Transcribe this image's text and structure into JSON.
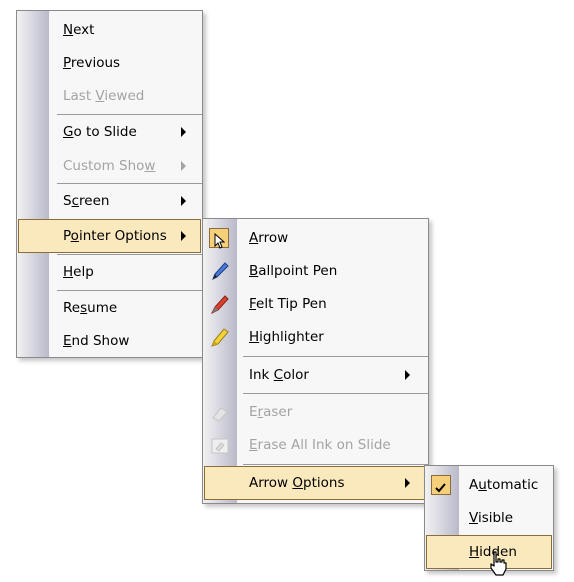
{
  "menu1": {
    "items": [
      {
        "pre": "",
        "key": "N",
        "post": "ext"
      },
      {
        "pre": "",
        "key": "P",
        "post": "revious"
      },
      {
        "pre": "Last ",
        "key": "V",
        "post": "iewed"
      },
      {
        "pre": "",
        "key": "G",
        "post": "o to Slide"
      },
      {
        "pre": "Custom Sho",
        "key": "w",
        "post": ""
      },
      {
        "pre": "S",
        "key": "c",
        "post": "reen"
      },
      {
        "pre": "P",
        "key": "o",
        "post": "inter Options"
      },
      {
        "pre": "",
        "key": "H",
        "post": "elp"
      },
      {
        "pre": "Re",
        "key": "s",
        "post": "ume"
      },
      {
        "pre": "",
        "key": "E",
        "post": "nd Show"
      }
    ]
  },
  "menu2": {
    "items": [
      {
        "pre": "",
        "key": "A",
        "post": "rrow",
        "icon": "arrow-cursor-icon"
      },
      {
        "pre": "",
        "key": "B",
        "post": "allpoint Pen",
        "icon": "ballpoint-pen-icon"
      },
      {
        "pre": "",
        "key": "F",
        "post": "elt Tip Pen",
        "icon": "felt-tip-pen-icon"
      },
      {
        "pre": "",
        "key": "H",
        "post": "ighlighter",
        "icon": "highlighter-icon"
      },
      {
        "pre": "Ink ",
        "key": "C",
        "post": "olor"
      },
      {
        "pre": "E",
        "key": "r",
        "post": "aser",
        "icon": "eraser-icon"
      },
      {
        "pre": "",
        "key": "E",
        "post": "rase All Ink on Slide",
        "icon": "erase-all-ink-icon"
      },
      {
        "pre": "Arrow ",
        "key": "O",
        "post": "ptions"
      }
    ]
  },
  "menu3": {
    "items": [
      {
        "pre": "A",
        "key": "u",
        "post": "tomatic",
        "checked": true
      },
      {
        "pre": "",
        "key": "V",
        "post": "isible"
      },
      {
        "pre": "",
        "key": "H",
        "post": "idden"
      }
    ]
  },
  "colors": {
    "highlight": "#fbe9be",
    "highlight_border": "#8a6d3b",
    "menu_bg": "#f7f7f7",
    "disabled_text": "#a3a3a3"
  }
}
